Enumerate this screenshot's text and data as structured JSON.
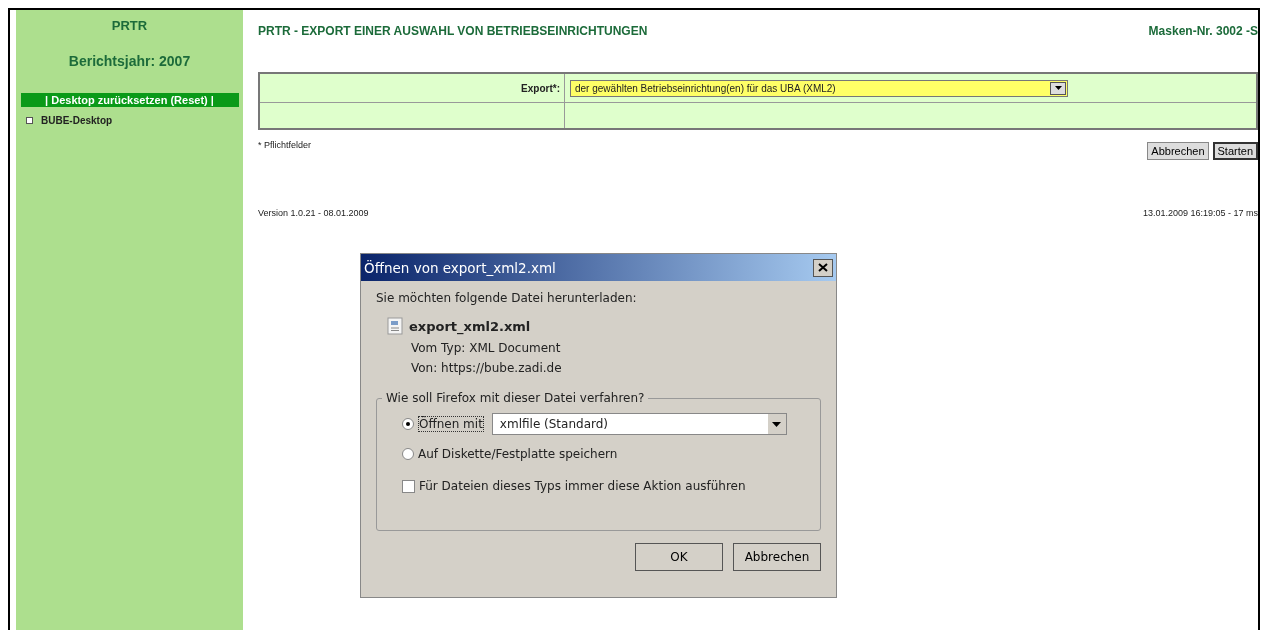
{
  "sidebar": {
    "title": "PRTR",
    "year": "Berichtsjahr: 2007",
    "reset_button": "| Desktop zurücksetzen (Reset) |",
    "items": [
      {
        "label": "BUBE-Desktop"
      }
    ]
  },
  "header": {
    "title": "PRTR - EXPORT EINER AUSWAHL VON BETRIEBSEINRICHTUNGEN",
    "mask_number": "Masken-Nr. 3002 -S"
  },
  "form": {
    "export_label": "Export*:",
    "export_value": "der gewählten Betriebseinrichtung(en) für das UBA (XML2)"
  },
  "required_note": "* Pflichtfelder",
  "buttons": [
    "Abbrechen",
    "Starten"
  ],
  "footer": {
    "version": "Version 1.0.21 - 08.01.2009",
    "timestamp": "13.01.2009 16:19:05  -  17 ms"
  },
  "dialog": {
    "title": "Öffnen von export_xml2.xml",
    "intro": "Sie möchten folgende Datei herunterladen:",
    "file_name": "export_xml2.xml",
    "file_type": "Vom Typ: XML Document",
    "source": "Von: https://bube.zadi.de",
    "group_label": "Wie soll Firefox mit dieser Datei verfahren?",
    "options": [
      {
        "label": "Öffnen mit",
        "selected": true,
        "kind": "open-with",
        "app": "xmlfile (Standard)"
      },
      {
        "label": "Auf Diskette/Festplatte speichern",
        "selected": false,
        "kind": "plain"
      }
    ],
    "always": {
      "label": "Für Dateien dieses Typs immer diese Aktion ausführen",
      "checked": false
    },
    "buttons": [
      "OK",
      "Abbrechen"
    ]
  }
}
